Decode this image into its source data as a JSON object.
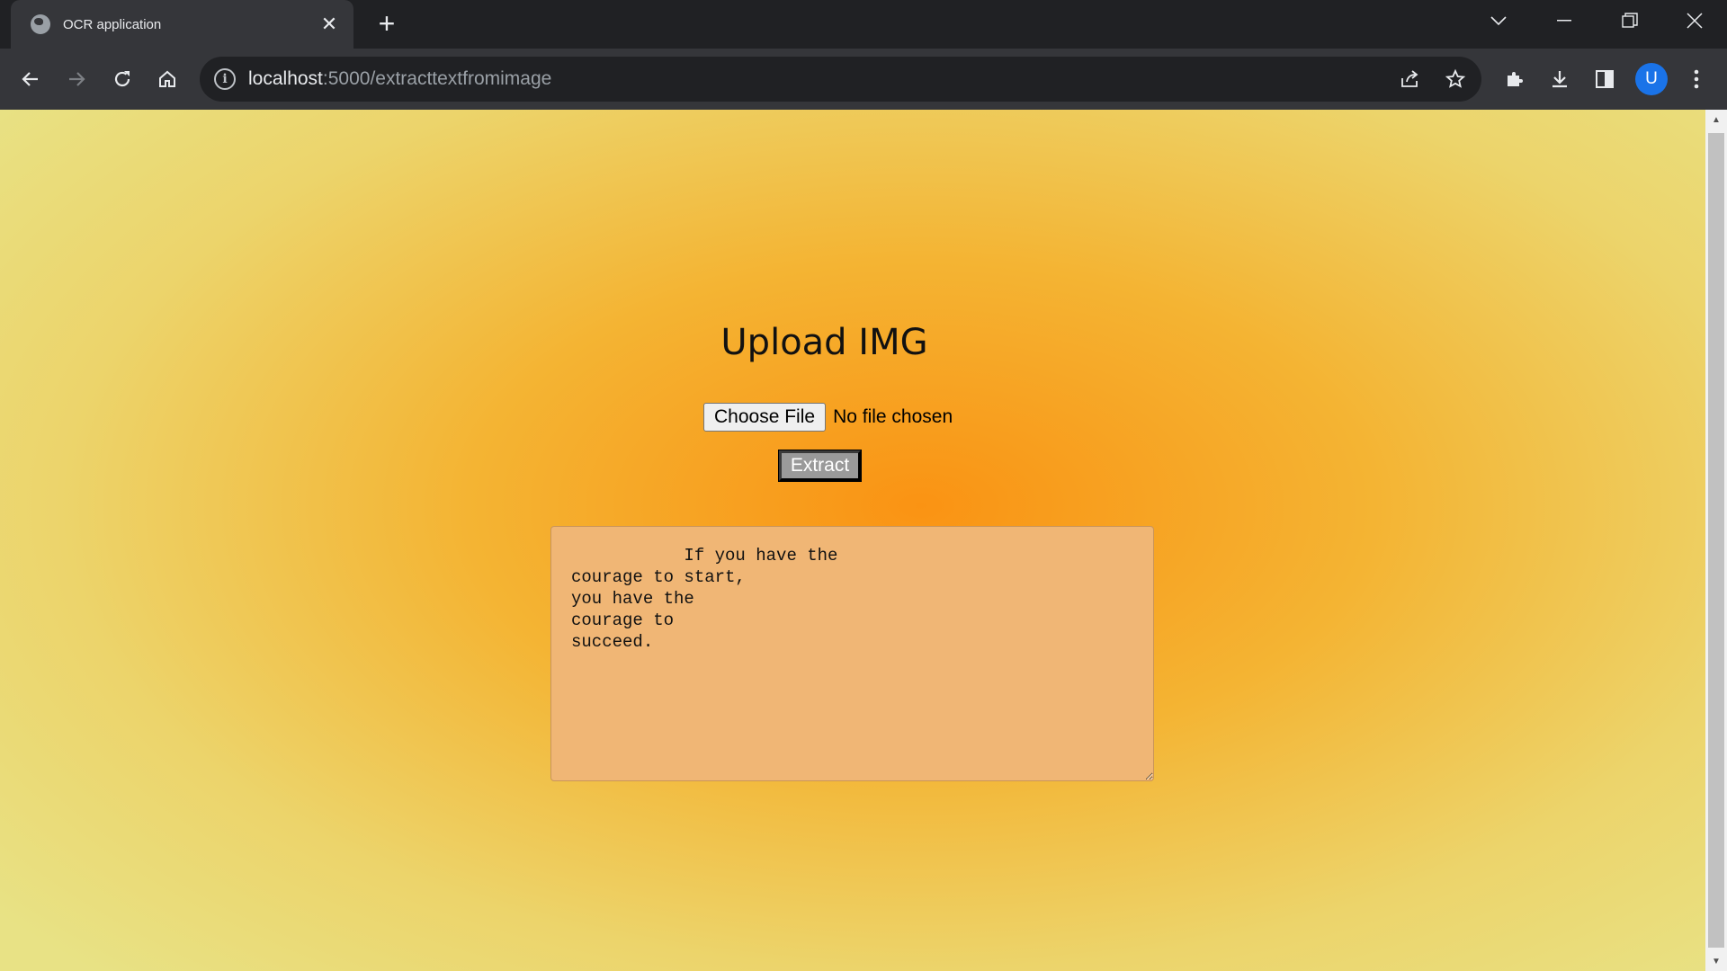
{
  "tab": {
    "title": "OCR application"
  },
  "omnibox": {
    "host": "localhost",
    "path": ":5000/extracttextfromimage"
  },
  "profile": {
    "initial": "U",
    "color": "#1a73e8"
  },
  "page": {
    "heading": "Upload IMG",
    "choose_file_label": "Choose File",
    "no_file_text": "No file chosen",
    "extract_label": "Extract",
    "output_text": "           If you have the\ncourage to start,\nyou have the\ncourage to\nsucceed."
  },
  "colors": {
    "gradient_center": "#fa9313",
    "gradient_edge": "#e8e285",
    "textarea_bg": "#f0b675"
  },
  "icons": [
    "globe-icon",
    "close-icon",
    "plus-icon",
    "chevron-down-icon",
    "minimize-icon",
    "restore-icon",
    "window-close-icon",
    "back-icon",
    "forward-icon",
    "reload-icon",
    "home-icon",
    "info-icon",
    "share-icon",
    "star-icon",
    "extensions-icon",
    "download-icon",
    "side-panel-icon",
    "menu-icon"
  ]
}
